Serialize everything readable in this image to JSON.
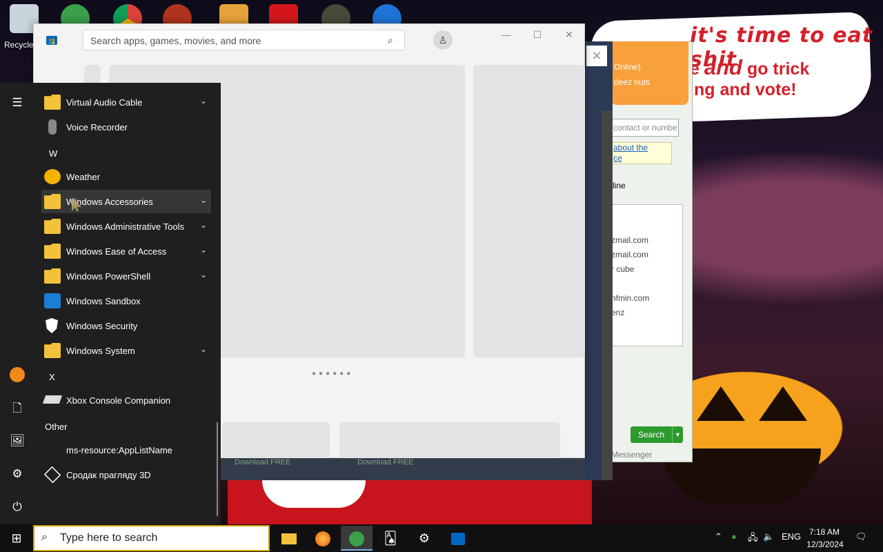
{
  "desktop": {
    "recycle_bin_label": "Recycle",
    "icons": [
      "recycle-bin",
      "messenger",
      "chrome",
      "opera",
      "archive",
      "flash",
      "game",
      "bird"
    ],
    "speech_bubble": {
      "line1": "it's time to eat shit",
      "line2_a": "e",
      "line2_b": "and",
      "line2_c": "go trick",
      "line3": "ng and vote!"
    }
  },
  "messenger": {
    "status_online": "Online)",
    "status_name": "deez nuts",
    "contact_placeholder": "contact or numbe",
    "note_line1": "about the",
    "note_line2": "ce",
    "online_header": "line",
    "contacts": [
      "zmail.com",
      "zmail.com",
      "r cube",
      "nfmin.com",
      "enz"
    ],
    "search_button": "Search",
    "footer": "Messenger"
  },
  "store": {
    "search_placeholder": "Search apps, games, movies, and more",
    "download_labels": [
      "Download FREE",
      "Download FREE"
    ],
    "colors": {
      "accent": "#0067c0",
      "background": "#f3f3f3"
    }
  },
  "start_menu": {
    "items": [
      {
        "type": "app",
        "label": "Virtual Audio Cable",
        "icon": "folder-icon",
        "expandable": true
      },
      {
        "type": "app",
        "label": "Voice Recorder",
        "icon": "microphone-icon",
        "expandable": false
      },
      {
        "type": "letter",
        "label": "W"
      },
      {
        "type": "app",
        "label": "Weather",
        "icon": "weather-icon",
        "expandable": false
      },
      {
        "type": "app",
        "label": "Windows Accessories",
        "icon": "folder-icon",
        "expandable": true,
        "hover": true
      },
      {
        "type": "app",
        "label": "Windows Administrative Tools",
        "icon": "folder-icon",
        "expandable": true
      },
      {
        "type": "app",
        "label": "Windows Ease of Access",
        "icon": "folder-icon",
        "expandable": true
      },
      {
        "type": "app",
        "label": "Windows PowerShell",
        "icon": "folder-icon",
        "expandable": true
      },
      {
        "type": "app",
        "label": "Windows Sandbox",
        "icon": "sandbox-icon",
        "expandable": false
      },
      {
        "type": "app",
        "label": "Windows Security",
        "icon": "shield-icon",
        "expandable": false
      },
      {
        "type": "app",
        "label": "Windows System",
        "icon": "folder-icon",
        "expandable": true
      },
      {
        "type": "letter",
        "label": "X"
      },
      {
        "type": "app",
        "label": "Xbox Console Companion",
        "icon": "xbox-icon",
        "expandable": false
      },
      {
        "type": "letter",
        "label": "Other"
      },
      {
        "type": "app",
        "label": "ms-resource:AppListName",
        "icon": "",
        "expandable": false
      },
      {
        "type": "app",
        "label": "Сродак прагляду 3D",
        "icon": "cube-icon",
        "expandable": false
      }
    ],
    "rail": [
      "hamburger-menu-icon",
      "user-avatar-icon",
      "documents-icon",
      "pictures-icon",
      "settings-icon",
      "power-icon"
    ]
  },
  "taskbar": {
    "search_placeholder": "Type here to search",
    "apps": [
      "file-explorer-icon",
      "firefox-icon",
      "messenger-icon",
      "solitaire-icon",
      "settings-icon",
      "store-icon"
    ],
    "tray_language": "ENG",
    "clock_time": "7:18 AM",
    "clock_date": "12/3/2024"
  }
}
